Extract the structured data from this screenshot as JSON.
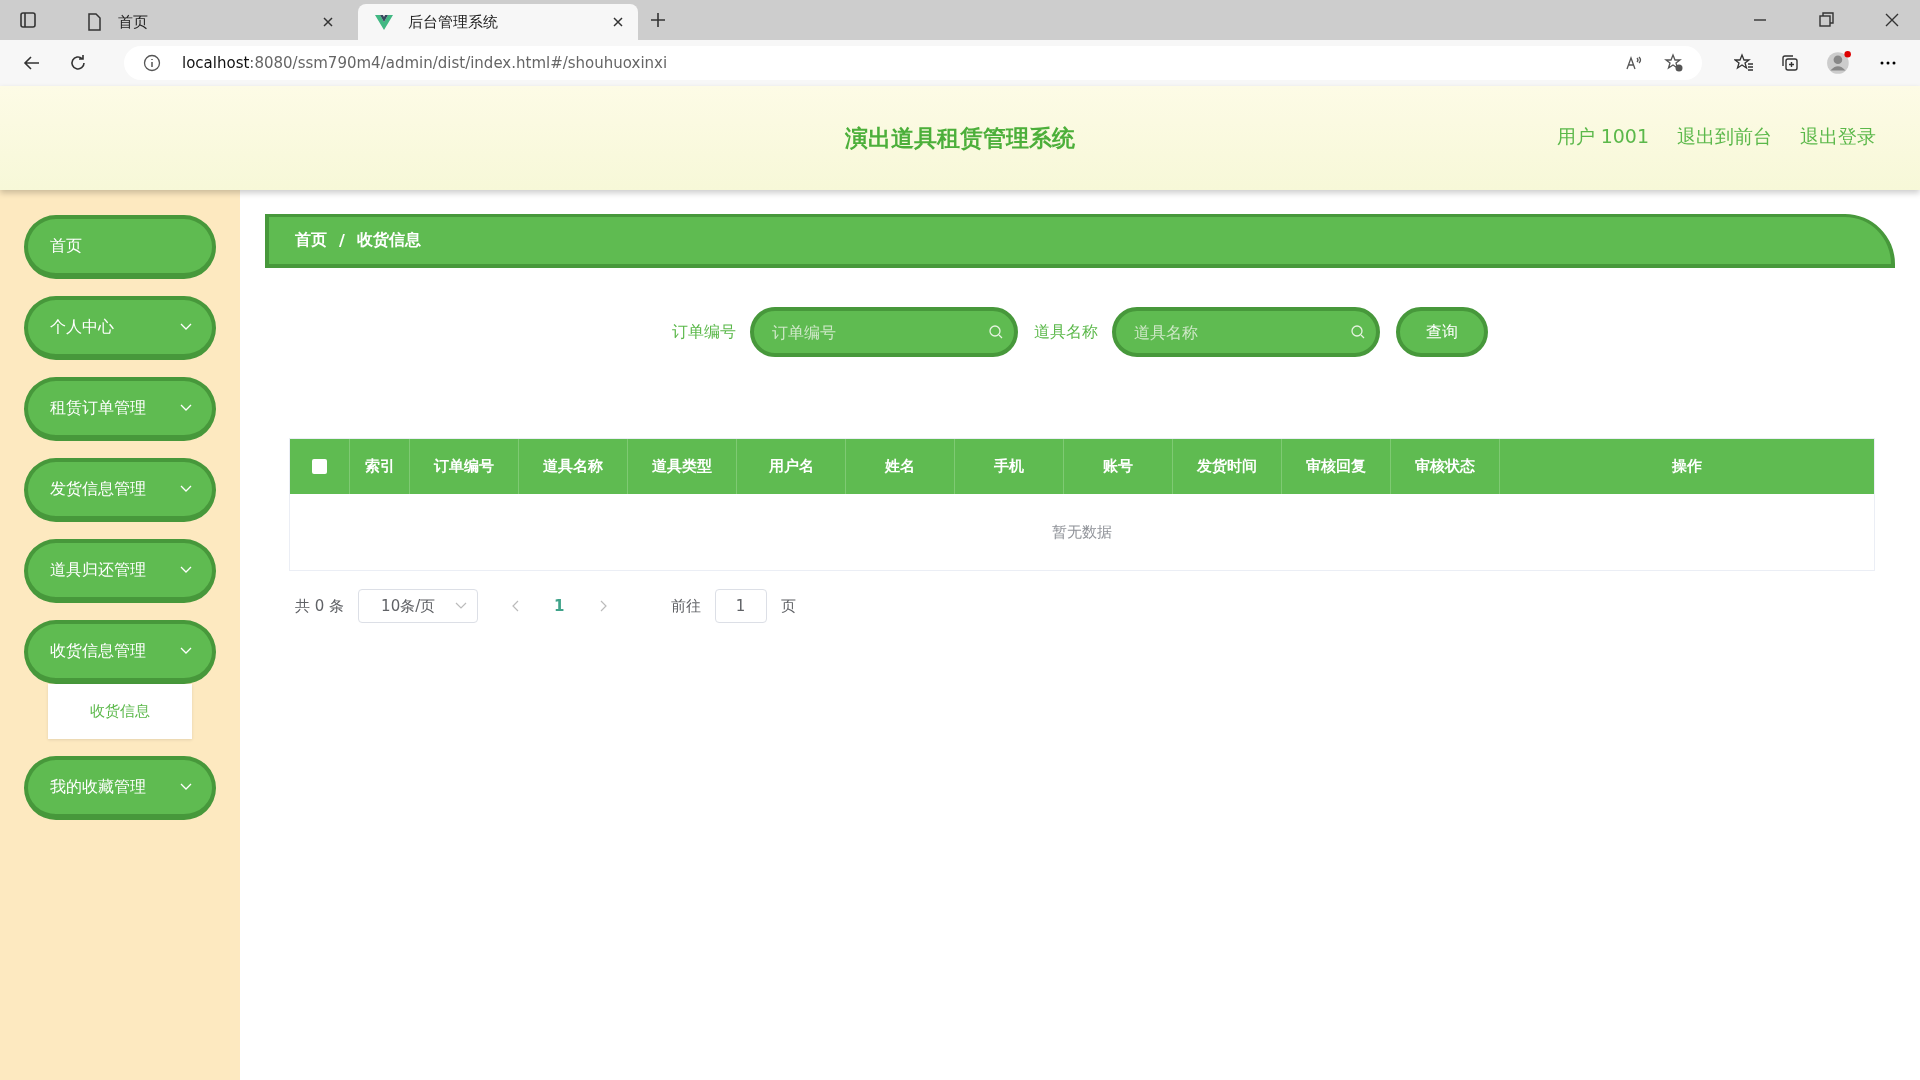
{
  "browser": {
    "tabs": [
      {
        "title": "首页",
        "selected": false,
        "kind": "page"
      },
      {
        "title": "后台管理系统",
        "selected": true,
        "kind": "vue"
      }
    ],
    "url": {
      "host": "localhost",
      "path": ":8080/ssm790m4/admin/dist/index.html#/shouhuoxinxi"
    }
  },
  "header": {
    "title": "演出道具租赁管理系统",
    "links": [
      "用户 1001",
      "退出到前台",
      "退出登录"
    ]
  },
  "sidebar": {
    "items": [
      {
        "label": "首页",
        "kind": "link"
      },
      {
        "label": "个人中心",
        "kind": "group"
      },
      {
        "label": "租赁订单管理",
        "kind": "group"
      },
      {
        "label": "发货信息管理",
        "kind": "group"
      },
      {
        "label": "道具归还管理",
        "kind": "group"
      },
      {
        "label": "收货信息管理",
        "kind": "group",
        "expanded": true,
        "children": [
          {
            "label": "收货信息"
          }
        ]
      },
      {
        "label": "我的收藏管理",
        "kind": "group"
      }
    ]
  },
  "breadcrumb": {
    "separator": "/",
    "items": [
      "首页",
      "收货信息"
    ]
  },
  "search": {
    "fields": [
      {
        "label": "订单编号",
        "placeholder": "订单编号"
      },
      {
        "label": "道具名称",
        "placeholder": "道具名称"
      }
    ],
    "button": "查询"
  },
  "table": {
    "select_all": {
      "checked": false
    },
    "columns": [
      "索引",
      "订单编号",
      "道具名称",
      "道具类型",
      "用户名",
      "姓名",
      "手机",
      "账号",
      "发货时间",
      "审核回复",
      "审核状态",
      "操作"
    ],
    "empty_text": "暂无数据"
  },
  "pagination": {
    "total": "共 0 条",
    "page_size": "10条/页",
    "pages": [
      {
        "label": "1",
        "selected": true
      }
    ],
    "goto_label": "前往",
    "goto_value": "1",
    "goto_suffix": "页"
  }
}
